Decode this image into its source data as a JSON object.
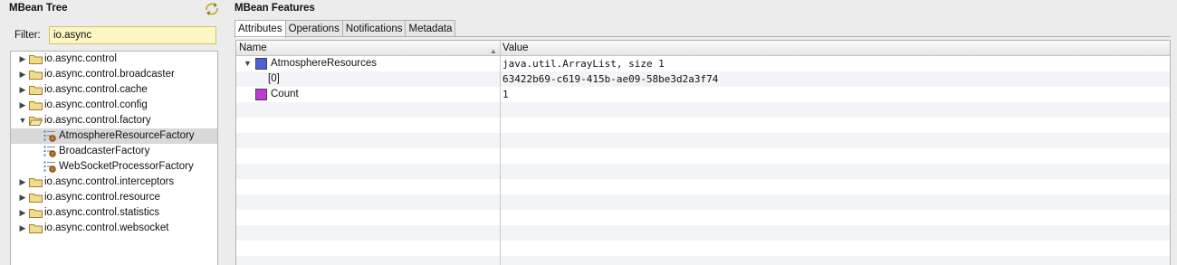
{
  "tree_panel": {
    "title": "MBean Tree",
    "refresh_icon": "sync-arrows-icon",
    "filter_label": "Filter:",
    "filter_value": "io.async",
    "items": [
      {
        "label": "io.async.control",
        "type": "folder",
        "expanded": false
      },
      {
        "label": "io.async.control.broadcaster",
        "type": "folder",
        "expanded": false
      },
      {
        "label": "io.async.control.cache",
        "type": "folder",
        "expanded": false
      },
      {
        "label": "io.async.control.config",
        "type": "folder",
        "expanded": false
      },
      {
        "label": "io.async.control.factory",
        "type": "folder",
        "expanded": true
      },
      {
        "label": "AtmosphereResourceFactory",
        "type": "mbean",
        "selected": true
      },
      {
        "label": "BroadcasterFactory",
        "type": "mbean"
      },
      {
        "label": "WebSocketProcessorFactory",
        "type": "mbean"
      },
      {
        "label": "io.async.control.interceptors",
        "type": "folder",
        "expanded": false
      },
      {
        "label": "io.async.control.resource",
        "type": "folder",
        "expanded": false
      },
      {
        "label": "io.async.control.statistics",
        "type": "folder",
        "expanded": false
      },
      {
        "label": "io.async.control.websocket",
        "type": "folder",
        "expanded": false
      }
    ]
  },
  "features_panel": {
    "title": "MBean Features",
    "tabs": [
      "Attributes",
      "Operations",
      "Notifications",
      "Metadata"
    ],
    "active_tab": "Attributes",
    "columns": {
      "name": "Name",
      "value": "Value"
    },
    "rows": [
      {
        "name": "AtmosphereResources",
        "value": "java.util.ArrayList, size 1",
        "expanded": true,
        "swatch": "#4a5fd9"
      },
      {
        "name": "[0]",
        "value": "63422b69-c619-415b-ae09-58be3d2a3f74",
        "child": true
      },
      {
        "name": "Count",
        "value": "1",
        "swatch": "#c23ad6"
      }
    ]
  },
  "colors": {
    "filter_bg": "#fbf6c4",
    "selection_bg": "#d8d8d8",
    "attribute_swatch": "#4a5fd9",
    "count_swatch": "#c23ad6"
  }
}
